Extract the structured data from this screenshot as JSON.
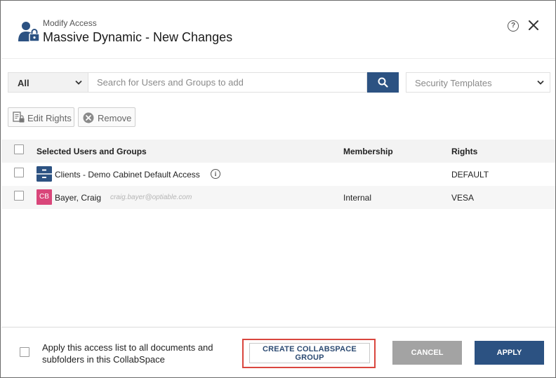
{
  "header": {
    "subtitle": "Modify Access",
    "title": "Massive Dynamic - New Changes",
    "help_label": "?",
    "icons": {
      "main": "user-lock-icon",
      "help": "help-circle-icon",
      "close": "close-icon"
    }
  },
  "search": {
    "type_value": "All",
    "placeholder": "Search for Users and Groups to add",
    "button_icon": "search-icon",
    "templates_placeholder": "Security Templates"
  },
  "actions": {
    "edit_rights": "Edit Rights",
    "remove": "Remove"
  },
  "table": {
    "headers": {
      "name": "Selected Users and Groups",
      "membership": "Membership",
      "rights": "Rights"
    },
    "rows": [
      {
        "name": "Clients - Demo Cabinet Default Access",
        "email": "",
        "membership": "",
        "rights": "DEFAULT",
        "icon": "cabinet-icon",
        "info_label": "i"
      },
      {
        "name": "Bayer, Craig",
        "email": "craig.bayer@optiable.com",
        "membership": "Internal",
        "rights": "VESA",
        "avatar_initials": "CB",
        "avatar_color": "#d9467a"
      }
    ]
  },
  "footer": {
    "apply_text": "Apply this access list to all documents and subfolders in this CollabSpace",
    "create_group": "CREATE COLLABSPACE GROUP",
    "cancel": "CANCEL",
    "apply": "APPLY"
  },
  "colors": {
    "primary": "#2c5282",
    "cancel_gray": "#a3a3a3",
    "highlight_red": "#d9463e"
  }
}
